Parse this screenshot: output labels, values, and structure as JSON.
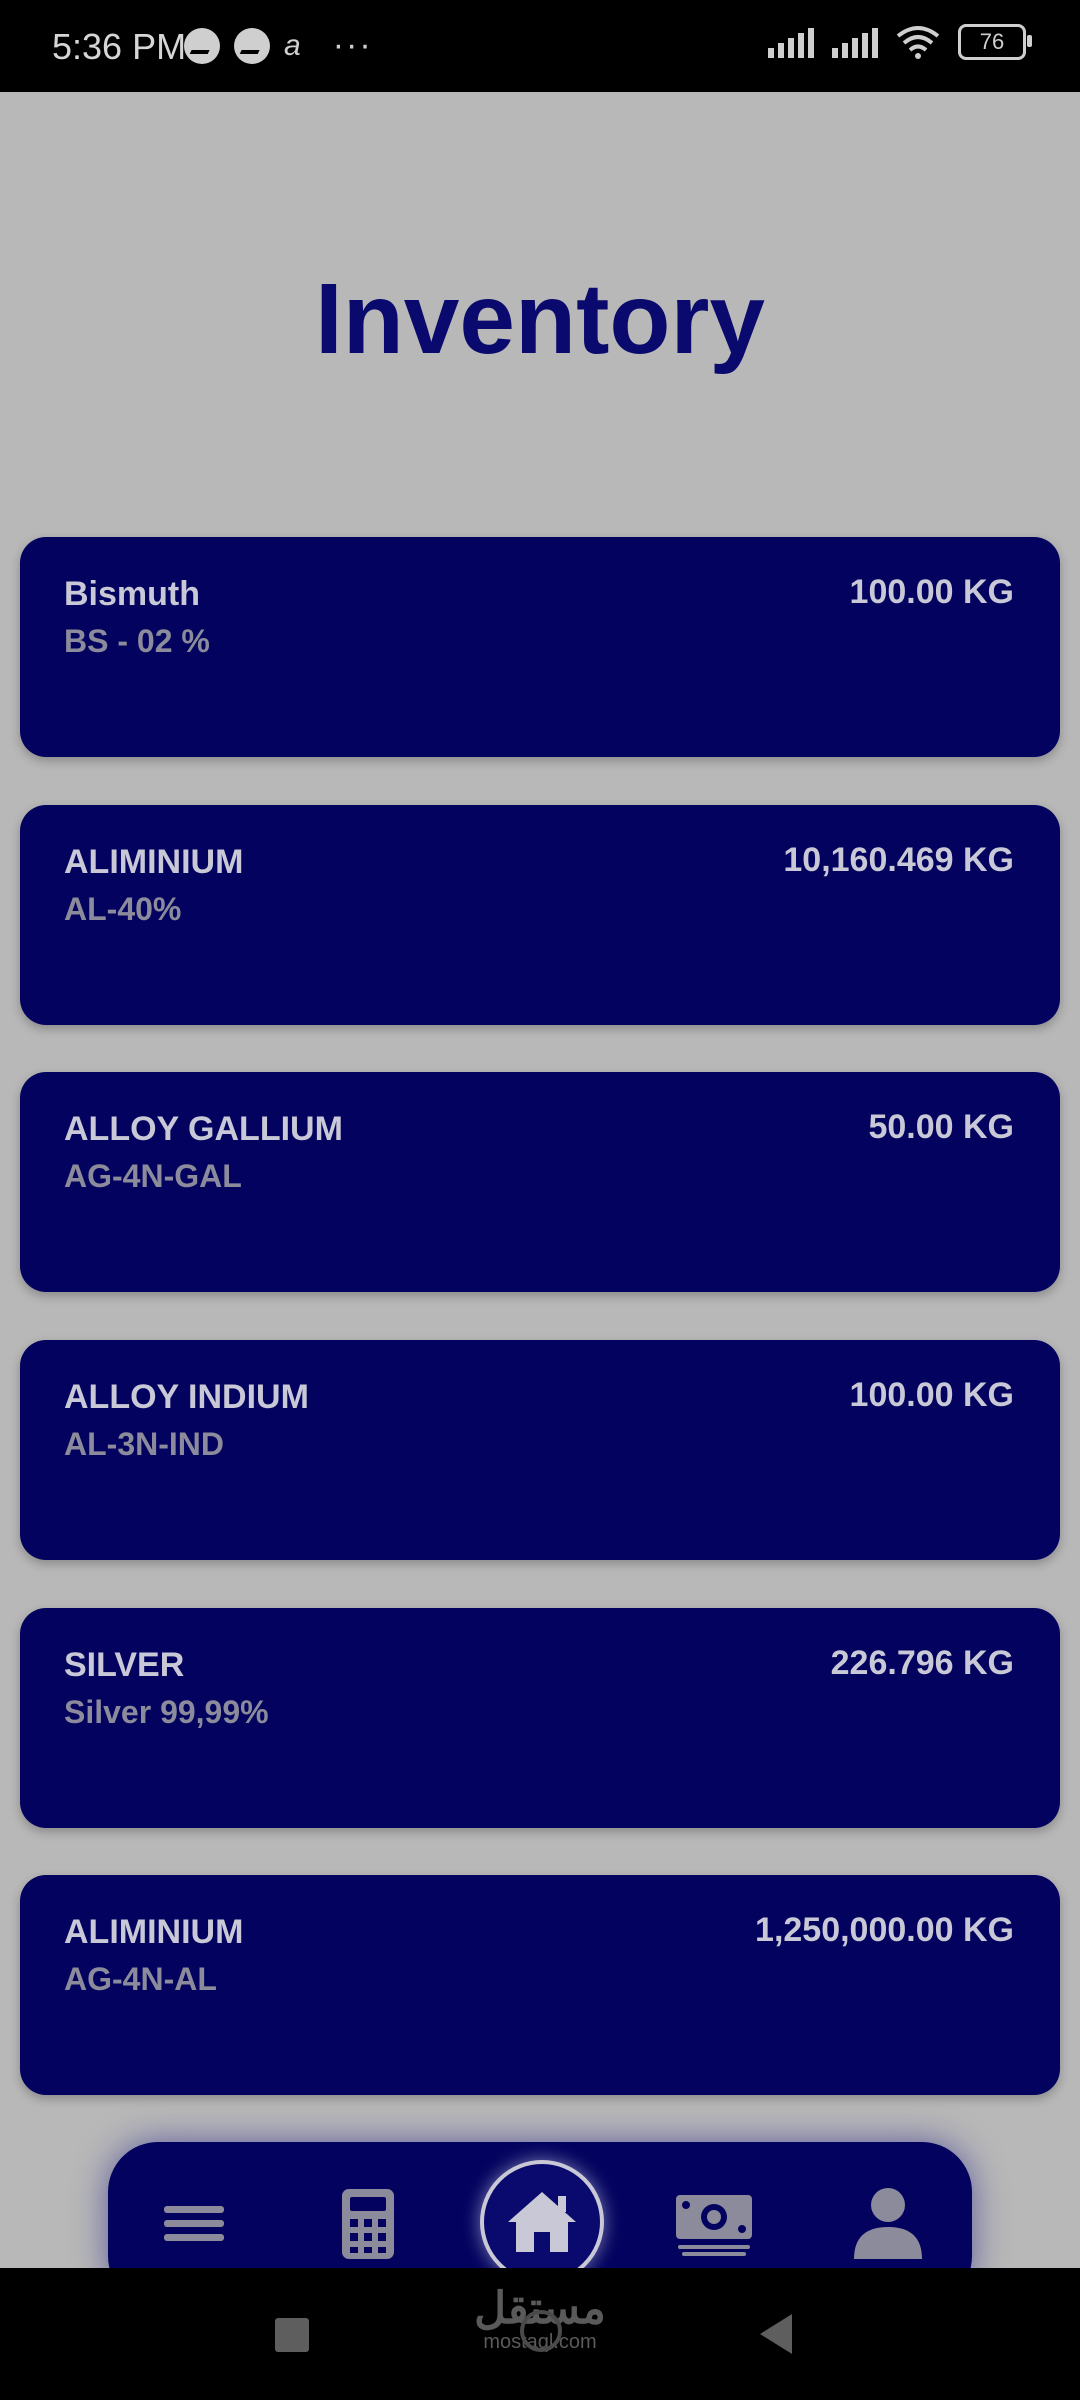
{
  "status_bar": {
    "time": "5:36 PM",
    "notification_icons": [
      "messenger-icon",
      "messenger-icon",
      "aliexpress-icon"
    ],
    "more": "···",
    "battery": "76"
  },
  "page": {
    "title": "Inventory"
  },
  "inventory": [
    {
      "name": "Bismuth",
      "code": "BS - 02 %",
      "qty": "100.00 KG"
    },
    {
      "name": "ALIMINIUM",
      "code": "AL-40%",
      "qty": "10,160.469 KG"
    },
    {
      "name": "ALLOY GALLIUM",
      "code": "AG-4N-GAL",
      "qty": "50.00 KG"
    },
    {
      "name": "ALLOY INDIUM",
      "code": "AL-3N-IND",
      "qty": "100.00 KG"
    },
    {
      "name": "SILVER",
      "code": "Silver 99,99%",
      "qty": "226.796 KG"
    },
    {
      "name": "ALIMINIUM",
      "code": "AG-4N-AL",
      "qty": "1,250,000.00 KG"
    }
  ],
  "bottom_nav": {
    "items": [
      "menu-icon",
      "calculator-icon",
      "home-icon",
      "money-icon",
      "profile-icon"
    ],
    "active": "home-icon"
  },
  "watermark": {
    "arabic": "مستقل",
    "latin": "mostaql.com"
  },
  "colors": {
    "background": "#b8b8b8",
    "card": "#03035f",
    "title": "#0a0a6e",
    "card_text": "#c8c8d6",
    "card_subtext": "#8b8b9b"
  }
}
